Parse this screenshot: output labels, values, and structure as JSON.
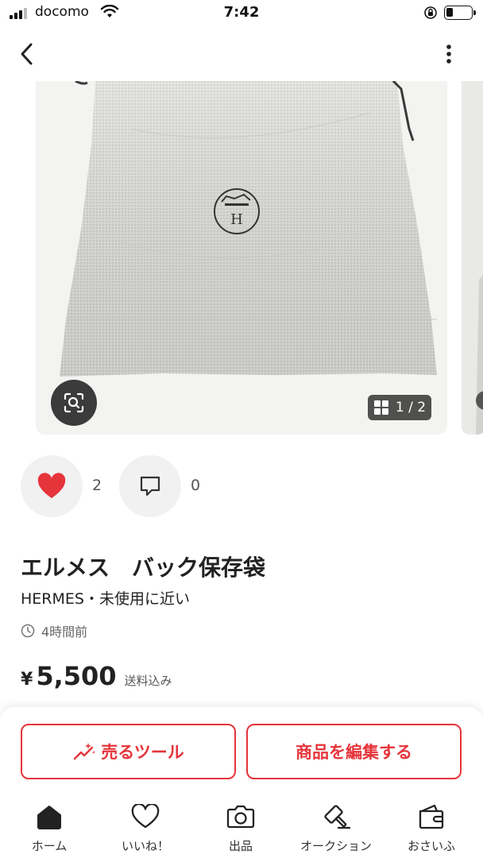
{
  "status_bar": {
    "carrier": "docomo",
    "time": "7:42"
  },
  "nav": {
    "back_icon": "chevron-left-icon",
    "more_icon": "vertical-dots-icon"
  },
  "gallery": {
    "current": "1",
    "total": "2",
    "counter_label": "1 / 2",
    "image_description": "dust-bag-photo"
  },
  "actions": {
    "like_count": "2",
    "comment_count": "0",
    "like_color": "#e6343b"
  },
  "item": {
    "title": "エルメス　バック保存袋",
    "brand_condition": "HERMES・未使用に近い",
    "posted": "4時間前",
    "currency": "¥",
    "price": "5,500",
    "shipping": "送料込み"
  },
  "buttons": {
    "sell_tool": "売るツール",
    "edit": "商品を編集する",
    "accent": "#e6343b"
  },
  "tabbar": {
    "items": [
      {
        "label": "ホーム",
        "icon": "home-icon"
      },
      {
        "label": "いいね！",
        "icon": "heart-icon"
      },
      {
        "label": "出品",
        "icon": "camera-icon"
      },
      {
        "label": "オークション",
        "icon": "gavel-icon"
      },
      {
        "label": "おさいふ",
        "icon": "wallet-icon"
      }
    ]
  }
}
